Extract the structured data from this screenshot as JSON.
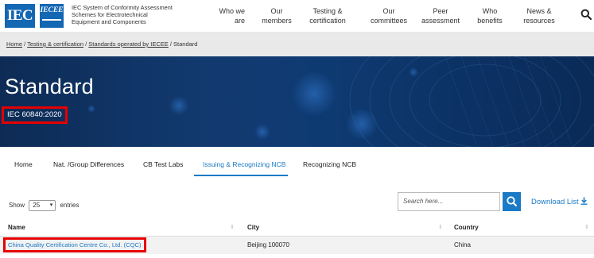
{
  "header": {
    "logo_iec": "IEC",
    "logo_iecee": "IECEE",
    "org_lines": [
      "IEC System of Conformity Assessment",
      "Schemes for Electrotechnical",
      "Equipment and Components"
    ],
    "nav": [
      {
        "line1": "Who we",
        "line2": "are"
      },
      {
        "line1": "Our",
        "line2": "members"
      },
      {
        "line1": "Testing &",
        "line2": "certification"
      },
      {
        "line1": "Our",
        "line2": "committees"
      },
      {
        "line1": "Peer",
        "line2": "assessment"
      },
      {
        "line1": "Who",
        "line2": "benefits"
      },
      {
        "line1": "News &",
        "line2": "resources"
      }
    ]
  },
  "breadcrumb": {
    "items": [
      "Home",
      "Testing & certification",
      "Standards operated by IECEE"
    ],
    "current": "Standard",
    "separator": " / "
  },
  "hero": {
    "title": "Standard",
    "subtitle": "IEC 60840:2020"
  },
  "tabs": [
    {
      "label": "Home",
      "active": false
    },
    {
      "label": "Nat. /Group Differences",
      "active": false
    },
    {
      "label": "CB Test Labs",
      "active": false
    },
    {
      "label": "Issuing & Recognizing NCB",
      "active": true
    },
    {
      "label": "Recognizing NCB",
      "active": false
    }
  ],
  "controls": {
    "show_label": "Show",
    "page_size": "25",
    "entries_label": "entries",
    "search_placeholder": "Search here...",
    "download_label": "Download List"
  },
  "table": {
    "columns": [
      "Name",
      "City",
      "Country"
    ],
    "rows": [
      {
        "name": "China Quality Certification Centre Co., Ltd. (CQC)",
        "city": "Beijing 100070",
        "country": "China"
      }
    ]
  },
  "colors": {
    "brand_blue": "#1467b3",
    "accent_blue": "#1a7ac6",
    "highlight_red": "#e60000",
    "hero_dark": "#0d2b55"
  }
}
